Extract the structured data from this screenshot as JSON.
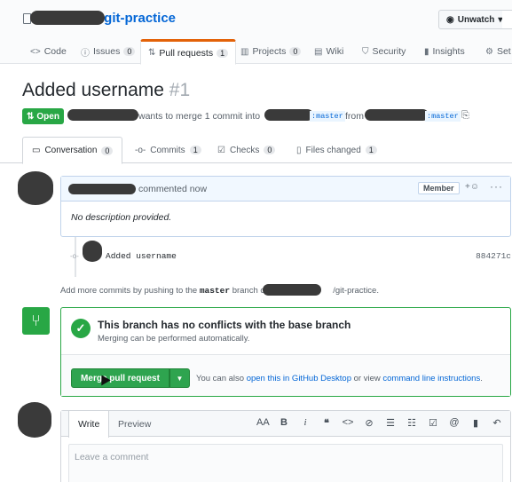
{
  "repo": {
    "name": "git-practice",
    "separator": "/",
    "unwatch_label": "Unwatch"
  },
  "nav": {
    "tabs": [
      {
        "label": "Code",
        "icon": "code-icon",
        "count": ""
      },
      {
        "label": "Issues",
        "icon": "issue-icon",
        "count": "0"
      },
      {
        "label": "Pull requests",
        "icon": "pull-request-icon",
        "count": "1"
      },
      {
        "label": "Projects",
        "icon": "project-icon",
        "count": "0"
      },
      {
        "label": "Wiki",
        "icon": "book-icon",
        "count": ""
      },
      {
        "label": "Security",
        "icon": "shield-icon",
        "count": ""
      },
      {
        "label": "Insights",
        "icon": "graph-icon",
        "count": ""
      },
      {
        "label": "Set",
        "icon": "gear-icon",
        "count": ""
      }
    ]
  },
  "pr": {
    "title": "Added username",
    "number": "#1",
    "state": "Open",
    "meta_text": "wants to merge 1 commit into",
    "base_branch": ":master",
    "from_text": "from",
    "head_branch": ":master"
  },
  "pr_tabs": [
    {
      "label": "Conversation",
      "count": "0",
      "icon": "comment-icon"
    },
    {
      "label": "Commits",
      "count": "1",
      "icon": "commit-icon"
    },
    {
      "label": "Checks",
      "count": "0",
      "icon": "checks-icon"
    },
    {
      "label": "Files changed",
      "count": "1",
      "icon": "file-diff-icon"
    }
  ],
  "comment": {
    "action": "commented now",
    "role_badge": "Member",
    "body": "No description provided."
  },
  "commit": {
    "message": "Added username",
    "sha": "884271c"
  },
  "add_commits": {
    "prefix": "Add more commits by pushing to the",
    "branch": "master",
    "middle": "branch on",
    "repo": "/git-practice."
  },
  "merge": {
    "heading": "This branch has no conflicts with the base branch",
    "sub": "Merging can be performed automatically.",
    "button_label": "Merge pull request",
    "alt_prefix": "You can also",
    "alt_link1": "open this in GitHub Desktop",
    "alt_middle": "or view",
    "alt_link2": "command line instructions",
    "alt_suffix": "."
  },
  "write": {
    "tab_write": "Write",
    "tab_preview": "Preview",
    "placeholder": "Leave a comment"
  },
  "colors": {
    "accent_orange": "#e36209",
    "success_green": "#28a745",
    "link_blue": "#0366d6"
  }
}
